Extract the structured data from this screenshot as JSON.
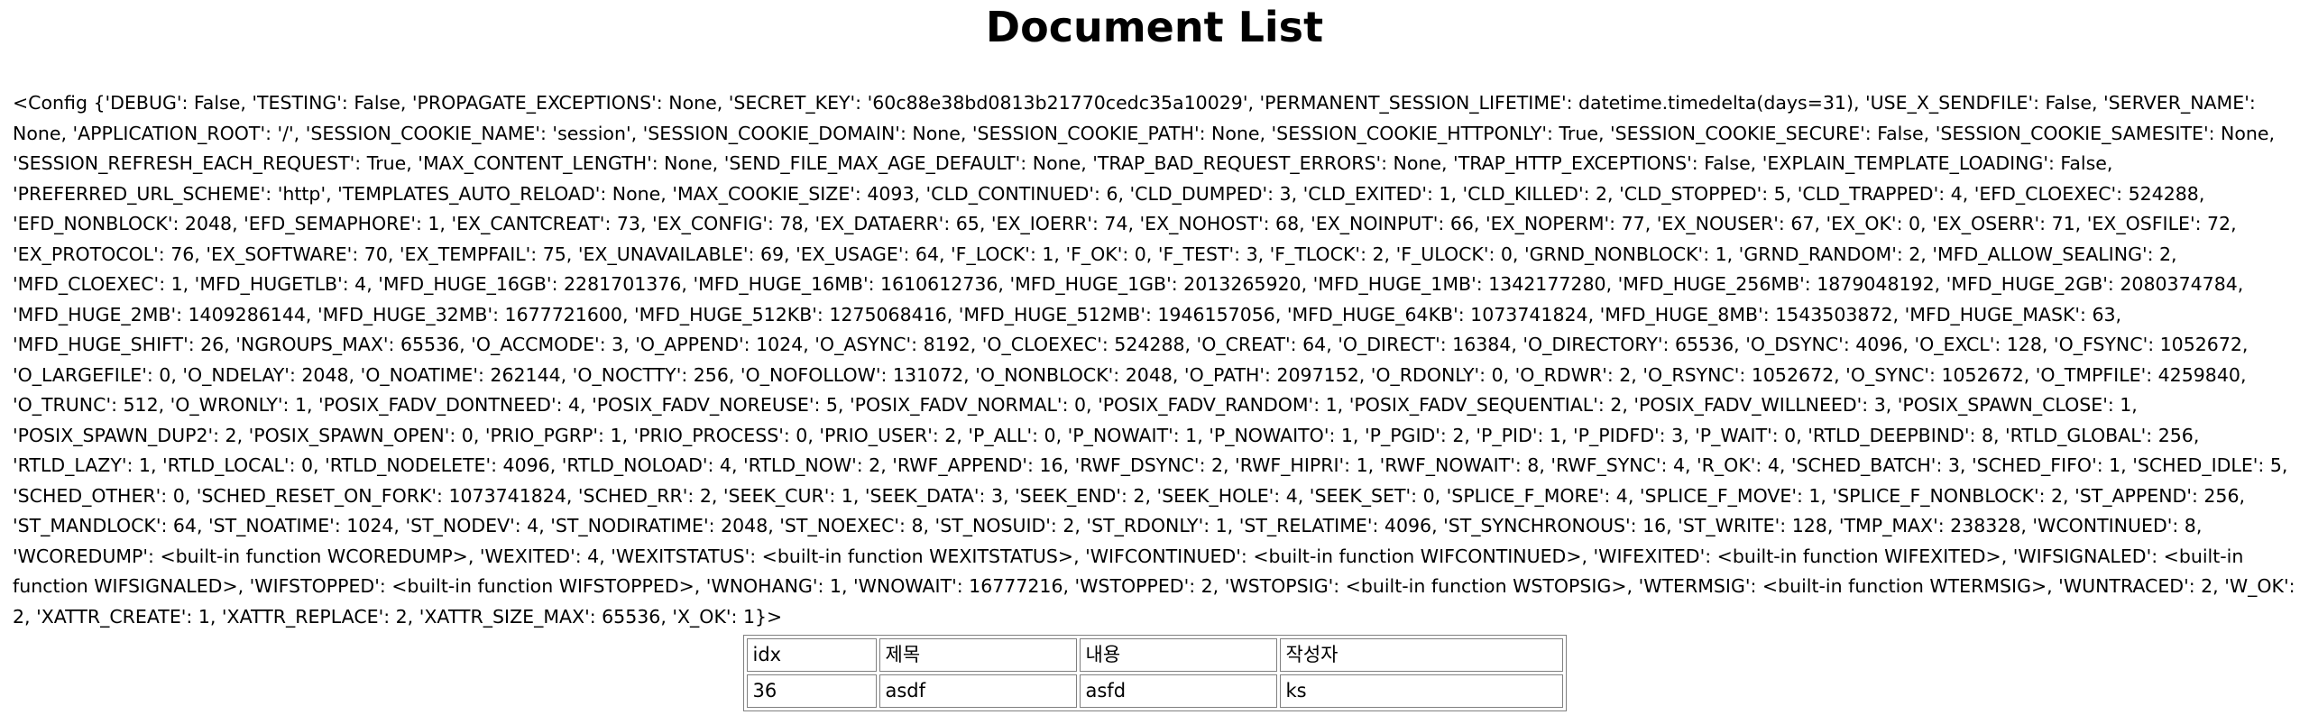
{
  "page": {
    "title": "Document List"
  },
  "config_dump": "<Config {'DEBUG': False, 'TESTING': False, 'PROPAGATE_EXCEPTIONS': None, 'SECRET_KEY': '60c88e38bd0813b21770cedc35a10029', 'PERMANENT_SESSION_LIFETIME': datetime.timedelta(days=31), 'USE_X_SENDFILE': False, 'SERVER_NAME': None, 'APPLICATION_ROOT': '/', 'SESSION_COOKIE_NAME': 'session', 'SESSION_COOKIE_DOMAIN': None, 'SESSION_COOKIE_PATH': None, 'SESSION_COOKIE_HTTPONLY': True, 'SESSION_COOKIE_SECURE': False, 'SESSION_COOKIE_SAMESITE': None, 'SESSION_REFRESH_EACH_REQUEST': True, 'MAX_CONTENT_LENGTH': None, 'SEND_FILE_MAX_AGE_DEFAULT': None, 'TRAP_BAD_REQUEST_ERRORS': None, 'TRAP_HTTP_EXCEPTIONS': False, 'EXPLAIN_TEMPLATE_LOADING': False, 'PREFERRED_URL_SCHEME': 'http', 'TEMPLATES_AUTO_RELOAD': None, 'MAX_COOKIE_SIZE': 4093, 'CLD_CONTINUED': 6, 'CLD_DUMPED': 3, 'CLD_EXITED': 1, 'CLD_KILLED': 2, 'CLD_STOPPED': 5, 'CLD_TRAPPED': 4, 'EFD_CLOEXEC': 524288, 'EFD_NONBLOCK': 2048, 'EFD_SEMAPHORE': 1, 'EX_CANTCREAT': 73, 'EX_CONFIG': 78, 'EX_DATAERR': 65, 'EX_IOERR': 74, 'EX_NOHOST': 68, 'EX_NOINPUT': 66, 'EX_NOPERM': 77, 'EX_NOUSER': 67, 'EX_OK': 0, 'EX_OSERR': 71, 'EX_OSFILE': 72, 'EX_PROTOCOL': 76, 'EX_SOFTWARE': 70, 'EX_TEMPFAIL': 75, 'EX_UNAVAILABLE': 69, 'EX_USAGE': 64, 'F_LOCK': 1, 'F_OK': 0, 'F_TEST': 3, 'F_TLOCK': 2, 'F_ULOCK': 0, 'GRND_NONBLOCK': 1, 'GRND_RANDOM': 2, 'MFD_ALLOW_SEALING': 2, 'MFD_CLOEXEC': 1, 'MFD_HUGETLB': 4, 'MFD_HUGE_16GB': 2281701376, 'MFD_HUGE_16MB': 1610612736, 'MFD_HUGE_1GB': 2013265920, 'MFD_HUGE_1MB': 1342177280, 'MFD_HUGE_256MB': 1879048192, 'MFD_HUGE_2GB': 2080374784, 'MFD_HUGE_2MB': 1409286144, 'MFD_HUGE_32MB': 1677721600, 'MFD_HUGE_512KB': 1275068416, 'MFD_HUGE_512MB': 1946157056, 'MFD_HUGE_64KB': 1073741824, 'MFD_HUGE_8MB': 1543503872, 'MFD_HUGE_MASK': 63, 'MFD_HUGE_SHIFT': 26, 'NGROUPS_MAX': 65536, 'O_ACCMODE': 3, 'O_APPEND': 1024, 'O_ASYNC': 8192, 'O_CLOEXEC': 524288, 'O_CREAT': 64, 'O_DIRECT': 16384, 'O_DIRECTORY': 65536, 'O_DSYNC': 4096, 'O_EXCL': 128, 'O_FSYNC': 1052672, 'O_LARGEFILE': 0, 'O_NDELAY': 2048, 'O_NOATIME': 262144, 'O_NOCTTY': 256, 'O_NOFOLLOW': 131072, 'O_NONBLOCK': 2048, 'O_PATH': 2097152, 'O_RDONLY': 0, 'O_RDWR': 2, 'O_RSYNC': 1052672, 'O_SYNC': 1052672, 'O_TMPFILE': 4259840, 'O_TRUNC': 512, 'O_WRONLY': 1, 'POSIX_FADV_DONTNEED': 4, 'POSIX_FADV_NOREUSE': 5, 'POSIX_FADV_NORMAL': 0, 'POSIX_FADV_RANDOM': 1, 'POSIX_FADV_SEQUENTIAL': 2, 'POSIX_FADV_WILLNEED': 3, 'POSIX_SPAWN_CLOSE': 1, 'POSIX_SPAWN_DUP2': 2, 'POSIX_SPAWN_OPEN': 0, 'PRIO_PGRP': 1, 'PRIO_PROCESS': 0, 'PRIO_USER': 2, 'P_ALL': 0, 'P_NOWAIT': 1, 'P_NOWAITO': 1, 'P_PGID': 2, 'P_PID': 1, 'P_PIDFD': 3, 'P_WAIT': 0, 'RTLD_DEEPBIND': 8, 'RTLD_GLOBAL': 256, 'RTLD_LAZY': 1, 'RTLD_LOCAL': 0, 'RTLD_NODELETE': 4096, 'RTLD_NOLOAD': 4, 'RTLD_NOW': 2, 'RWF_APPEND': 16, 'RWF_DSYNC': 2, 'RWF_HIPRI': 1, 'RWF_NOWAIT': 8, 'RWF_SYNC': 4, 'R_OK': 4, 'SCHED_BATCH': 3, 'SCHED_FIFO': 1, 'SCHED_IDLE': 5, 'SCHED_OTHER': 0, 'SCHED_RESET_ON_FORK': 1073741824, 'SCHED_RR': 2, 'SEEK_CUR': 1, 'SEEK_DATA': 3, 'SEEK_END': 2, 'SEEK_HOLE': 4, 'SEEK_SET': 0, 'SPLICE_F_MORE': 4, 'SPLICE_F_MOVE': 1, 'SPLICE_F_NONBLOCK': 2, 'ST_APPEND': 256, 'ST_MANDLOCK': 64, 'ST_NOATIME': 1024, 'ST_NODEV': 4, 'ST_NODIRATIME': 2048, 'ST_NOEXEC': 8, 'ST_NOSUID': 2, 'ST_RDONLY': 1, 'ST_RELATIME': 4096, 'ST_SYNCHRONOUS': 16, 'ST_WRITE': 128, 'TMP_MAX': 238328, 'WCONTINUED': 8, 'WCOREDUMP': <built-in function WCOREDUMP>, 'WEXITED': 4, 'WEXITSTATUS': <built-in function WEXITSTATUS>, 'WIFCONTINUED': <built-in function WIFCONTINUED>, 'WIFEXITED': <built-in function WIFEXITED>, 'WIFSIGNALED': <built-in function WIFSIGNALED>, 'WIFSTOPPED': <built-in function WIFSTOPPED>, 'WNOHANG': 1, 'WNOWAIT': 16777216, 'WSTOPPED': 2, 'WSTOPSIG': <built-in function WSTOPSIG>, 'WTERMSIG': <built-in function WTERMSIG>, 'WUNTRACED': 2, 'W_OK': 2, 'XATTR_CREATE': 1, 'XATTR_REPLACE': 2, 'XATTR_SIZE_MAX': 65536, 'X_OK': 1}>",
  "table": {
    "headers": {
      "idx": "idx",
      "title": "제목",
      "content": "내용",
      "author": "작성자"
    },
    "rows": [
      {
        "idx": "36",
        "title": "asdf",
        "content": "asfd",
        "author": "ks"
      }
    ]
  }
}
